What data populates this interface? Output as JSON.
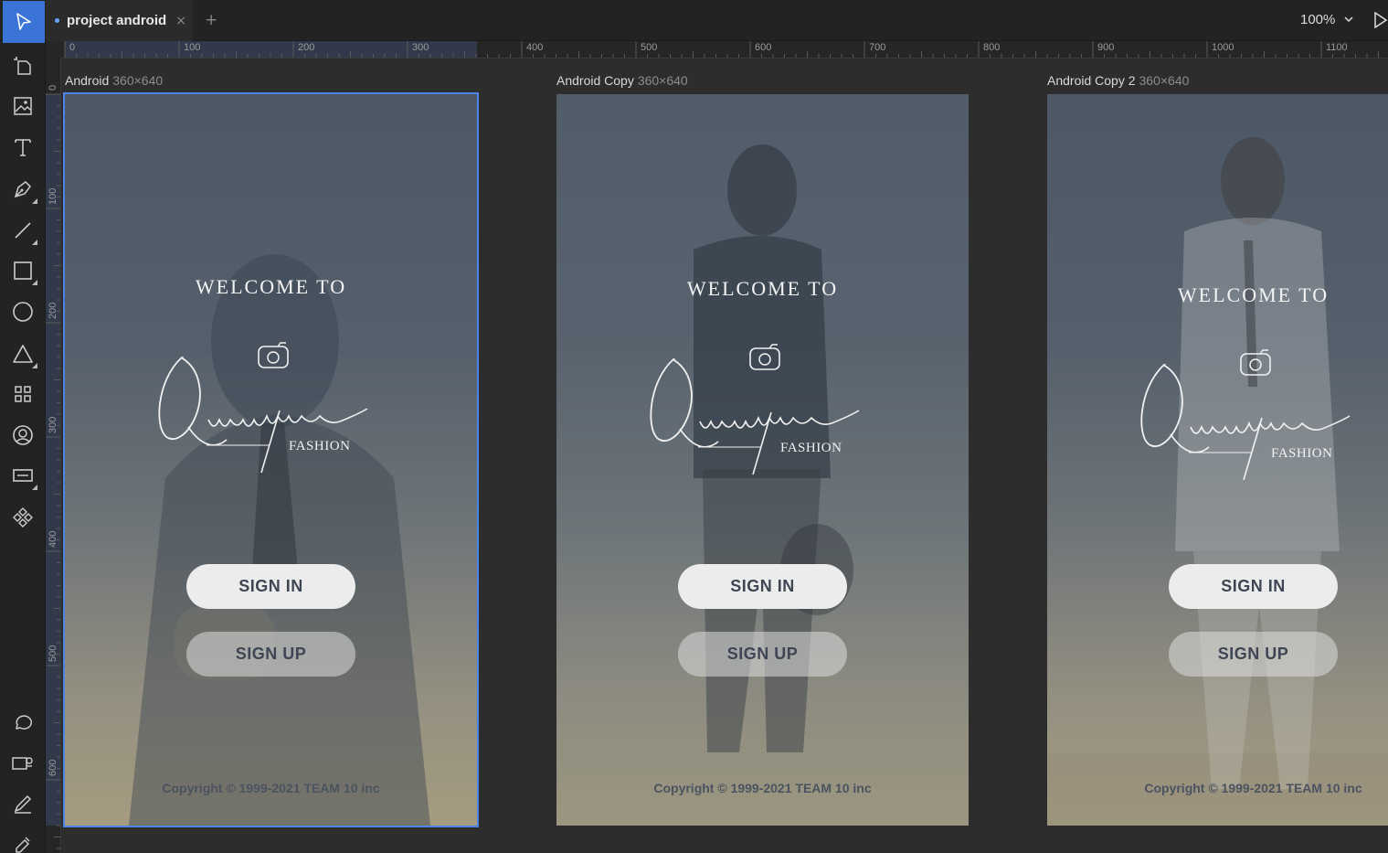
{
  "tab": {
    "name": "project android",
    "close": "×",
    "add": "+"
  },
  "zoom": {
    "value": "100%"
  },
  "tools": [
    "select-tool",
    "artboard-tool",
    "image-tool",
    "text-tool",
    "pen-tool",
    "line-tool",
    "rectangle-tool",
    "ellipse-tool",
    "triangle-tool",
    "grid-tool",
    "avatar-tool",
    "input-tool",
    "component-tool",
    "comment-tool",
    "prototype-tool",
    "pencil-tool",
    "eyedropper-tool"
  ],
  "ruler": {
    "top": [
      "0",
      "100",
      "200",
      "300",
      "400",
      "500",
      "600",
      "700",
      "800",
      "900",
      "1000",
      "1100"
    ],
    "left": [
      "0",
      "100",
      "200",
      "300",
      "400",
      "500",
      "600"
    ]
  },
  "artboards": [
    {
      "label": "Android",
      "dim": "360×640",
      "welcome": "WELCOME TO",
      "logo_script": "Quangtran",
      "logo_sub": "FASHION",
      "signin": "SIGN IN",
      "signup": "SIGN UP",
      "copyright": "Copyright © 1999-2021 TEAM 10 inc"
    },
    {
      "label": "Android Copy",
      "dim": "360×640",
      "welcome": "WELCOME TO",
      "logo_script": "Quangtran",
      "logo_sub": "FASHION",
      "signin": "SIGN IN",
      "signup": "SIGN UP",
      "copyright": "Copyright © 1999-2021 TEAM 10 inc"
    },
    {
      "label": "Android Copy 2",
      "dim": "360×640",
      "welcome": "WELCOME TO",
      "logo_script": "Quangtran",
      "logo_sub": "FASHION",
      "signin": "SIGN IN",
      "signup": "SIGN UP",
      "copyright": "Copyright © 1999-2021 TEAM 10 inc"
    }
  ]
}
